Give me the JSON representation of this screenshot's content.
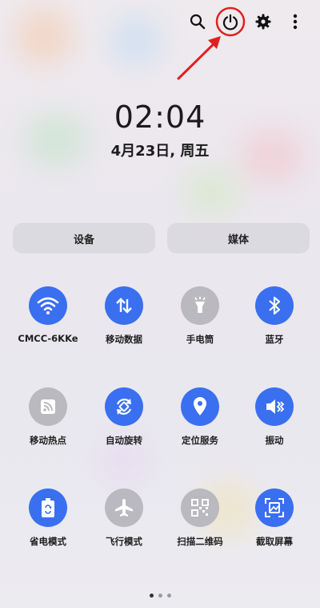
{
  "clock": {
    "time": "02:04",
    "date": "4月23日, 周五"
  },
  "segments": {
    "device_label": "设备",
    "media_label": "媒体"
  },
  "tiles": [
    {
      "label": "CMCC-6KKe",
      "icon": "wifi-icon",
      "state": "on"
    },
    {
      "label": "移动数据",
      "icon": "mobile-data-icon",
      "state": "on"
    },
    {
      "label": "手电筒",
      "icon": "flashlight-icon",
      "state": "off"
    },
    {
      "label": "蓝牙",
      "icon": "bluetooth-icon",
      "state": "on"
    },
    {
      "label": "移动热点",
      "icon": "hotspot-icon",
      "state": "off"
    },
    {
      "label": "自动旋转",
      "icon": "auto-rotate-icon",
      "state": "on"
    },
    {
      "label": "定位服务",
      "icon": "location-icon",
      "state": "on"
    },
    {
      "label": "振动",
      "icon": "vibrate-icon",
      "state": "on"
    },
    {
      "label": "省电模式",
      "icon": "power-saving-icon",
      "state": "on"
    },
    {
      "label": "飞行模式",
      "icon": "airplane-icon",
      "state": "off"
    },
    {
      "label": "扫描二维码",
      "icon": "qr-scan-icon",
      "state": "off"
    },
    {
      "label": "截取屏幕",
      "icon": "screenshot-icon",
      "state": "on"
    }
  ],
  "top_icons": [
    "search-icon",
    "power-icon",
    "settings-icon",
    "more-icon"
  ],
  "pagination": {
    "pages": 3,
    "current": 1
  },
  "colors": {
    "accent": "#3a6ff0",
    "inactive": "#b9b9bf",
    "annotation": "#e02020"
  }
}
